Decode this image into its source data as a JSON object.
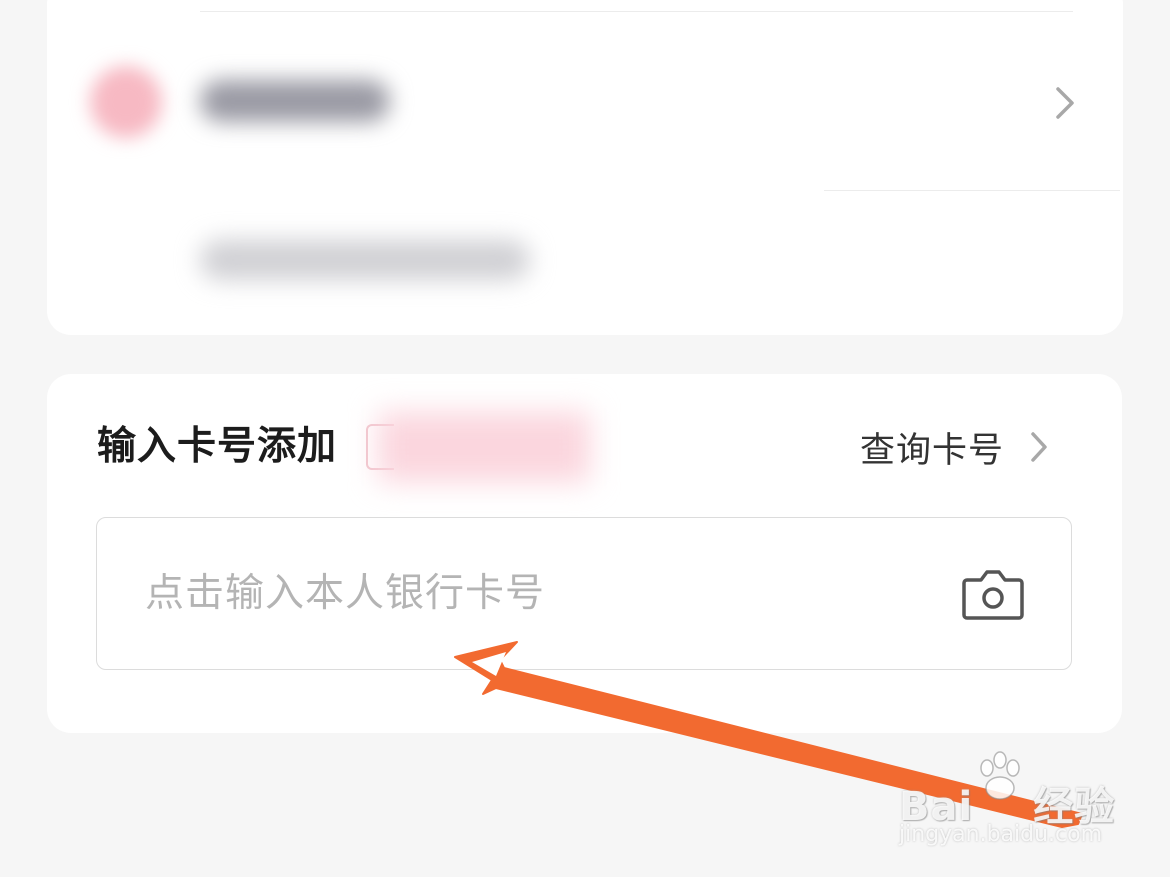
{
  "add_card": {
    "title": "输入卡号添加",
    "query_label": "查询卡号",
    "input_placeholder": "点击输入本人银行卡号",
    "input_value": ""
  },
  "icons": {
    "row_chevron": "chevron-right-icon",
    "query_chevron": "chevron-right-icon",
    "camera": "camera-icon",
    "annotation": "arrow-annotation"
  },
  "colors": {
    "background": "#f6f6f6",
    "card": "#ffffff",
    "title_text": "#1c1c1c",
    "placeholder_text": "#b4b4b4",
    "annotation_arrow": "#f26a30"
  },
  "watermark": {
    "brand": "Bai",
    "brand_tail": "经验",
    "url": "jingyan.baidu.com"
  }
}
